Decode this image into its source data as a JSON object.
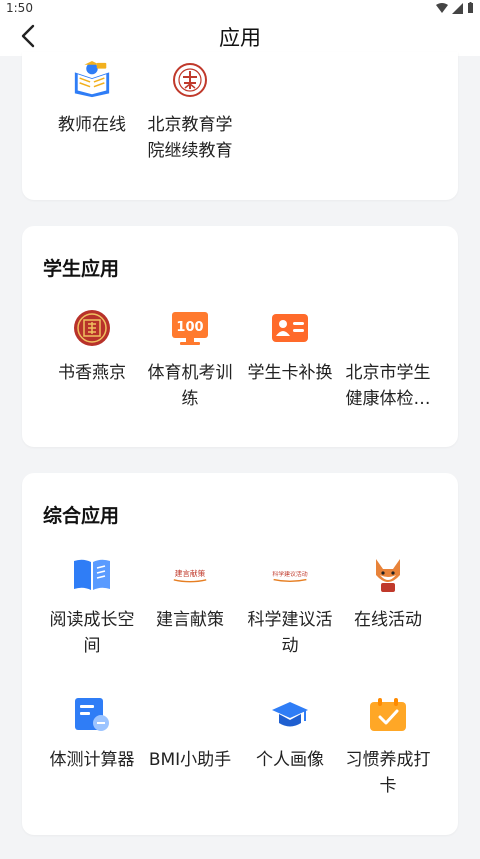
{
  "status_bar": {
    "time": "1:50"
  },
  "header": {
    "title": "应用"
  },
  "top_apps": [
    {
      "label": "教师在线",
      "icon": "teacher-online-icon"
    },
    {
      "label": "北京教育学院继续教育",
      "icon": "beijing-institute-seal-icon"
    }
  ],
  "student_section": {
    "title": "学生应用",
    "apps": [
      {
        "label": "书香燕京",
        "icon": "shuxiang-seal-icon"
      },
      {
        "label": "体育机考训练",
        "icon": "sports-exam-icon"
      },
      {
        "label": "学生卡补换",
        "icon": "student-card-icon"
      },
      {
        "label": "北京市学生健康体检…",
        "icon": "health-check-icon"
      }
    ]
  },
  "general_section": {
    "title": "综合应用",
    "apps": [
      {
        "label": "阅读成长空间",
        "icon": "book-icon"
      },
      {
        "label": "建言献策",
        "icon": "jianyan-banner-icon"
      },
      {
        "label": "科学建议活动",
        "icon": "science-banner-icon"
      },
      {
        "label": "在线活动",
        "icon": "fox-mascot-icon"
      },
      {
        "label": "体测计算器",
        "icon": "calculator-icon"
      },
      {
        "label": "BMI小助手",
        "icon": "bmi-icon"
      },
      {
        "label": "个人画像",
        "icon": "graduation-cap-icon"
      },
      {
        "label": "习惯养成打卡",
        "icon": "calendar-check-icon"
      }
    ]
  },
  "banner_text": {
    "jianyan": "建言献策",
    "science": "科学建议活动"
  },
  "colors": {
    "blue": "#2f7df6",
    "orange": "#ff7a2e",
    "red": "#c0392b"
  }
}
